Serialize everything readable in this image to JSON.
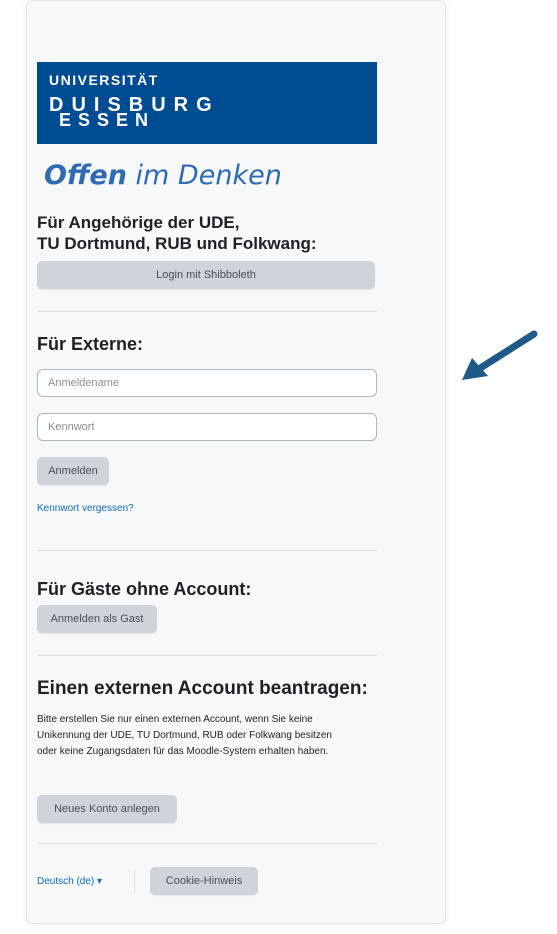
{
  "logo": {
    "line1": "UNIVERSITÄT",
    "line2": "DUISBURG",
    "line3": "ESSEN"
  },
  "slogan": {
    "bold": "Offen",
    "rest": " im Denken"
  },
  "ude_section": {
    "heading_line1": "Für Angehörige der UDE,",
    "heading_line2": "TU Dortmund, RUB und Folkwang:",
    "shibboleth_button": "Login mit Shibboleth"
  },
  "external": {
    "heading": "Für Externe:",
    "username_placeholder": "Anmeldename",
    "password_placeholder": "Kennwort",
    "login_button": "Anmelden",
    "forgot_link": "Kennwort vergessen?"
  },
  "guest": {
    "heading": "Für Gäste ohne Account:",
    "guest_button": "Anmelden als Gast"
  },
  "request_account": {
    "heading": "Einen externen Account beantragen:",
    "text": "Bitte erstellen Sie nur einen externen Account, wenn Sie keine Unikennung der UDE, TU Dortmund, RUB oder Folkwang besitzen oder keine Zugangsdaten für das Moodle-System erhalten haben.",
    "new_account_button": "Neues Konto anlegen"
  },
  "footer": {
    "language": "Deutsch (de) ▾",
    "cookie_button": "Cookie-Hinweis"
  },
  "colors": {
    "brand_blue": "#004c93",
    "slogan_blue": "#2f6ab3",
    "link_blue": "#0f6cbf",
    "arrow": "#1e5a85"
  }
}
